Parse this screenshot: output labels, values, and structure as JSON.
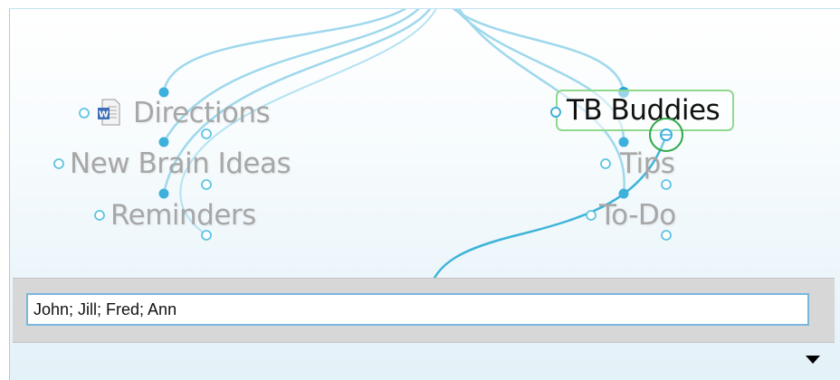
{
  "thoughts": [
    {
      "label": "Directions",
      "icon": "word-document-icon"
    },
    {
      "label": "New Brain Ideas"
    },
    {
      "label": "Reminders"
    },
    {
      "label": "TB Buddies",
      "active": true
    },
    {
      "label": "Tips"
    },
    {
      "label": "To-Do"
    }
  ],
  "editor": {
    "value": "John; Jill; Fred; Ann"
  },
  "panel_toggle_icon": "triangle-down-icon",
  "colors": {
    "link": "#5fc4e2",
    "node_fill": "#3eb0dc",
    "active_border": "#8fd88f",
    "gate_ring": "#2ea84a",
    "input_border": "#7ab6dc",
    "panel_bg": "#d7d7d7"
  }
}
